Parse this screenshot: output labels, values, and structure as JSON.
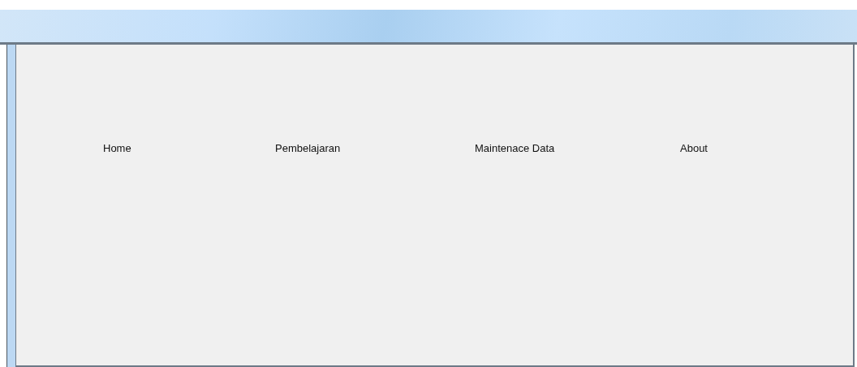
{
  "menu": {
    "items": [
      {
        "label": "Home"
      },
      {
        "label": "Pembelajaran"
      },
      {
        "label": "Maintenace Data"
      },
      {
        "label": "About"
      }
    ]
  }
}
